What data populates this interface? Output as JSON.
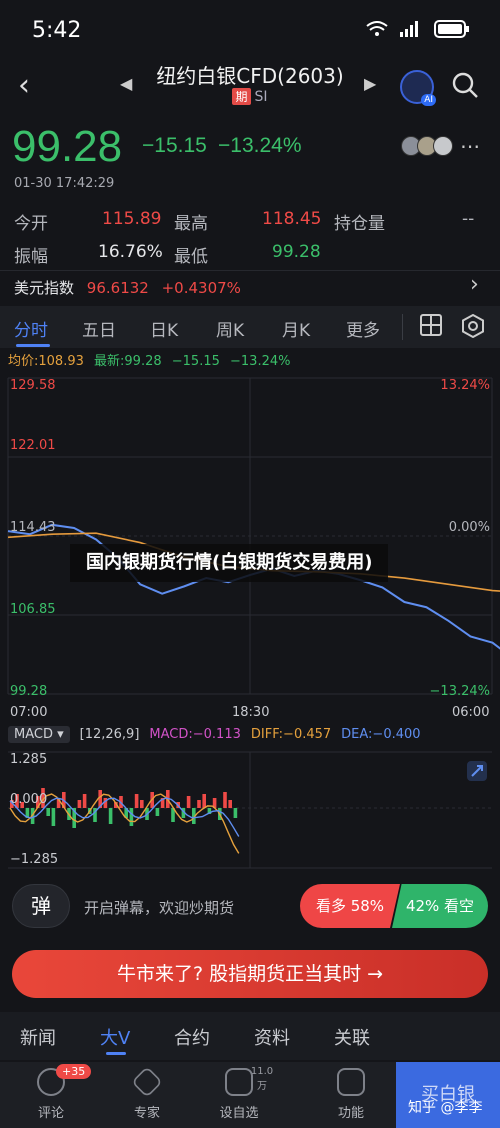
{
  "status": {
    "time": "5:42"
  },
  "nav": {
    "title": "纽约白银CFD(2603)",
    "badge": "期",
    "subtitle": "SI",
    "ai_label": "AI"
  },
  "quote": {
    "price": "99.28",
    "change": "−15.15",
    "change_pct": "−13.24%",
    "timestamp": "01-30 17:42:29"
  },
  "stats": {
    "open_label": "今开",
    "open_value": "115.89",
    "high_label": "最高",
    "high_value": "118.45",
    "oi_label": "持仓量",
    "oi_value": "--",
    "amp_label": "振幅",
    "amp_value": "16.76%",
    "low_label": "最低",
    "low_value": "99.28"
  },
  "usd_index": {
    "label": "美元指数",
    "value": "96.6132",
    "change": "+0.4307%"
  },
  "tabs": [
    "分时",
    "五日",
    "日K",
    "周K",
    "月K",
    "更多"
  ],
  "chart_info": {
    "avg_label": "均价:108.93",
    "latest_label": "最新:99.28",
    "change": "−15.15",
    "change_pct": "−13.24%"
  },
  "chart_data": {
    "type": "line",
    "title": "",
    "xlabel": "",
    "ylabel": "",
    "x_ticks": [
      "07:00",
      "18:30",
      "06:00"
    ],
    "y_ticks_left": [
      "129.58",
      "122.01",
      "114.43",
      "106.85",
      "99.28"
    ],
    "y_ticks_right": [
      "13.24%",
      "0.00%",
      "−13.24%"
    ],
    "ylim": [
      99.28,
      129.58
    ],
    "series": [
      {
        "x": [
          0,
          2,
          4,
          6,
          8,
          10,
          12,
          14,
          16,
          18,
          20,
          22,
          24,
          26,
          28,
          30,
          32,
          34,
          36,
          38,
          40,
          42,
          44,
          46,
          48,
          50
        ],
        "values": [
          114.9,
          114.6,
          115.5,
          115.2,
          114.1,
          112.3,
          109.8,
          108.9,
          109.6,
          110.4,
          110.0,
          110.7,
          111.3,
          110.6,
          111.1,
          110.8,
          110.2,
          109.5,
          108.1,
          107.6,
          106.3,
          104.8,
          104.2,
          102.6,
          101.1,
          99.28
        ]
      },
      {
        "x": [
          0,
          4,
          8,
          12,
          16,
          20,
          24,
          28,
          32,
          36,
          40,
          44,
          48,
          50
        ],
        "values": [
          114.3,
          114.6,
          114.7,
          113.8,
          112.4,
          111.5,
          111.1,
          111.0,
          110.8,
          110.4,
          109.8,
          109.2,
          108.9,
          108.93
        ]
      }
    ],
    "colors": {
      "price": "#5f8ef0",
      "average": "#e59a3d"
    }
  },
  "overlay": {
    "title": "国内银期货行情(白银期货交易费用)"
  },
  "macd": {
    "selector": "MACD",
    "params": "[12,26,9]",
    "macd": "MACD:−0.113",
    "diff": "DIFF:−0.457",
    "dea": "DEA:−0.400",
    "y_top": "1.285",
    "y_mid": "0.000",
    "y_bottom": "−1.285"
  },
  "danmu": {
    "icon": "弹",
    "text": "开启弹幕，欢迎炒期货",
    "bull": "看多 58%",
    "bear": "42% 看空"
  },
  "banner": {
    "text": "牛市来了? 股指期货正当其时 →"
  },
  "bottom_tabs": [
    "新闻",
    "大V",
    "合约",
    "资料",
    "关联"
  ],
  "toolbar": {
    "comment": "评论",
    "comment_badge": "+35",
    "expert": "专家",
    "alert": "设自选",
    "alert_count": "11.0万",
    "func": "功能",
    "trade": "买白银"
  },
  "watermark": "知乎 @李李"
}
